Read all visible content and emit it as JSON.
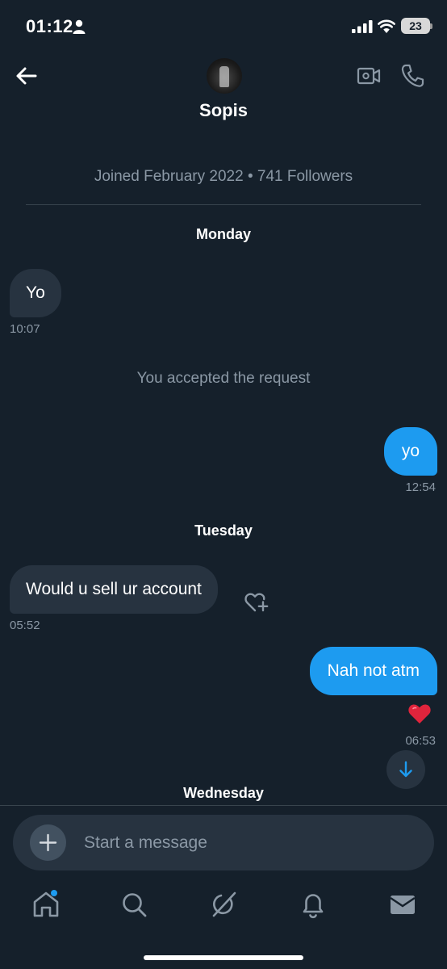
{
  "status_bar": {
    "time": "01:12",
    "battery": "23"
  },
  "header": {
    "name": "Sopis"
  },
  "profile_info": "Joined February 2022 • 741 Followers",
  "days": {
    "monday": "Monday",
    "tuesday": "Tuesday",
    "wednesday": "Wednesday"
  },
  "messages": [
    {
      "text": "Yo",
      "time": "10:07",
      "direction": "in"
    },
    {
      "text": "yo",
      "time": "12:54",
      "direction": "out"
    },
    {
      "text": "Would u sell ur account",
      "time": "05:52",
      "direction": "in"
    },
    {
      "text": "Nah not atm",
      "time": "06:53",
      "direction": "out",
      "reaction": "heart"
    }
  ],
  "system_message": "You accepted the request",
  "composer": {
    "placeholder": "Start a message"
  },
  "nav": {
    "items": [
      "home-icon",
      "search-icon",
      "grok-icon",
      "notifications-icon",
      "messages-icon"
    ],
    "active": "messages-icon"
  },
  "colors": {
    "background": "#15202b",
    "accent": "#1d9bf0",
    "incoming_bubble": "#273340",
    "muted_text": "#8b98a5"
  }
}
